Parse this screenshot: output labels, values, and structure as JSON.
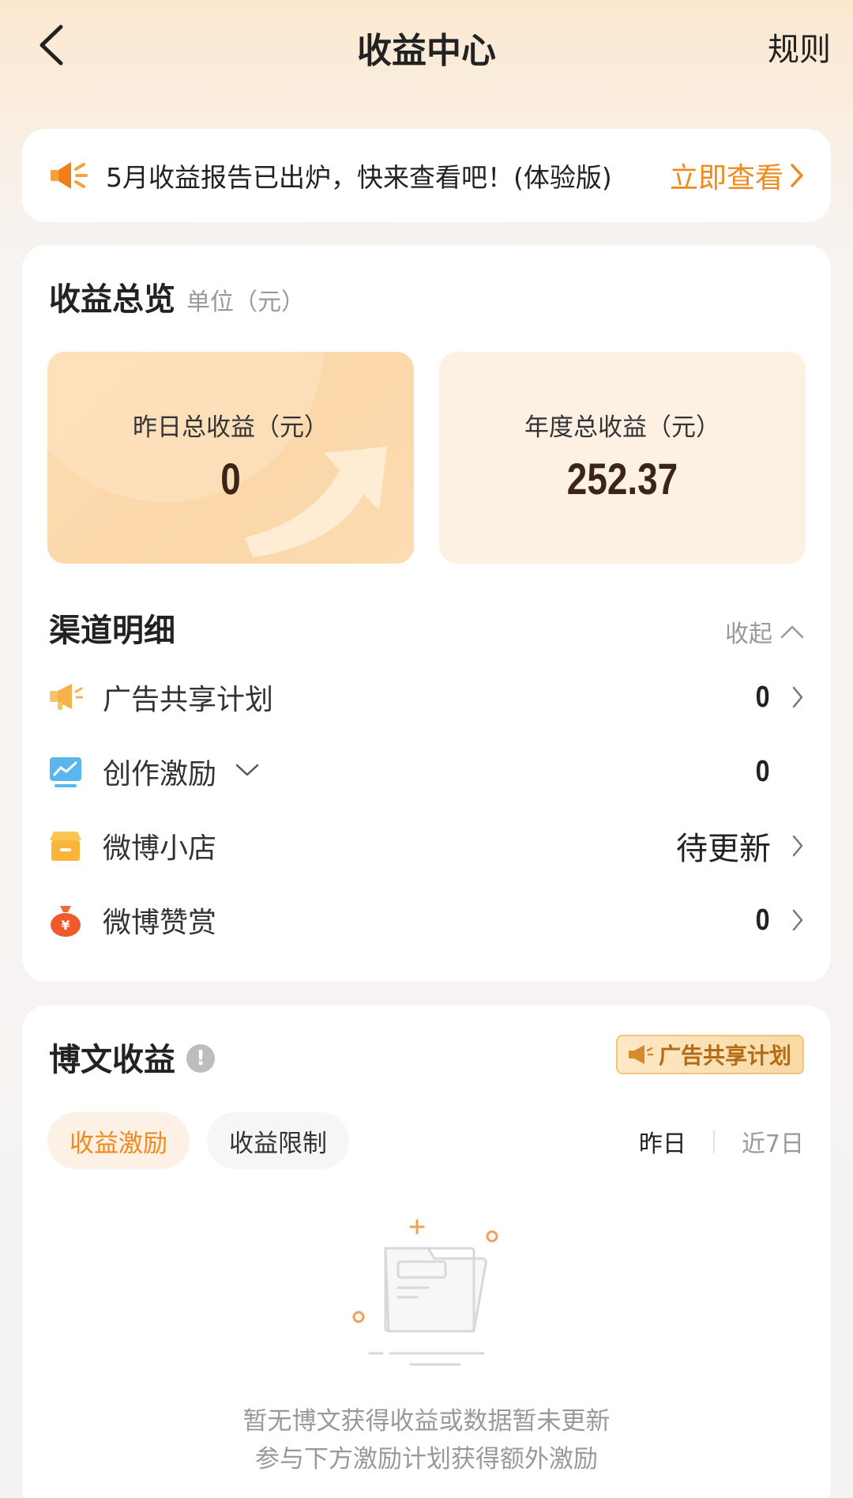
{
  "header": {
    "title": "收益中心",
    "rules_label": "规则"
  },
  "notice": {
    "text": "5月收益报告已出炉，快来查看吧！(体验版)",
    "cta_label": "立即查看"
  },
  "overview": {
    "title": "收益总览",
    "unit": "单位（元）",
    "yesterday": {
      "label": "昨日总收益（元）",
      "value": "0"
    },
    "annual": {
      "label": "年度总收益（元）",
      "value": "252.37"
    }
  },
  "channels": {
    "title": "渠道明细",
    "collapse_label": "收起",
    "items": [
      {
        "label": "广告共享计划",
        "value": "0",
        "icon": "megaphone-icon"
      },
      {
        "label": "创作激励",
        "value": "0",
        "icon": "chart-icon"
      },
      {
        "label": "微博小店",
        "value": "待更新",
        "icon": "shop-icon"
      },
      {
        "label": "微博赞赏",
        "value": "0",
        "icon": "money-bag-icon"
      }
    ]
  },
  "posts": {
    "title": "博文收益",
    "ad_badge": "广告共享计划",
    "tabs": [
      {
        "label": "收益激励",
        "active": true
      },
      {
        "label": "收益限制",
        "active": false
      }
    ],
    "ranges": [
      {
        "label": "昨日",
        "active": true
      },
      {
        "label": "近7日",
        "active": false
      }
    ],
    "empty_line1": "暂无博文获得收益或数据暂未更新",
    "empty_line2": "参与下方激励计划获得额外激励"
  },
  "colors": {
    "accent": "#f08a1c",
    "value_text": "#3b2418"
  }
}
